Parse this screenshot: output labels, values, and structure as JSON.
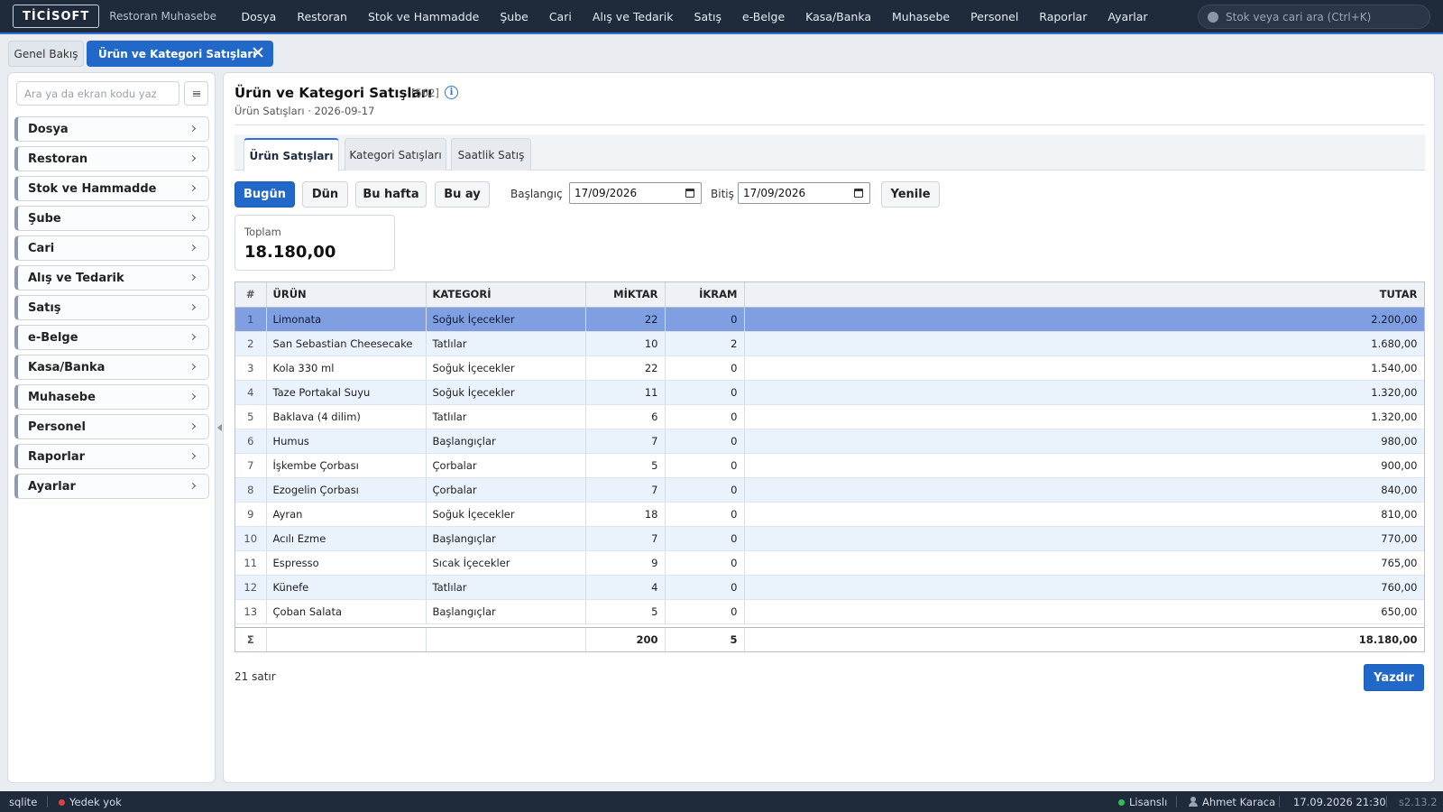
{
  "app": {
    "logo": "TİCİSOFT",
    "subtitle": "Restoran Muhasebe",
    "nav": [
      "Dosya",
      "Restoran",
      "Stok ve Hammadde",
      "Şube",
      "Cari",
      "Alış ve Tedarik",
      "Satış",
      "e-Belge",
      "Kasa/Banka",
      "Muhasebe",
      "Personel",
      "Raporlar",
      "Ayarlar"
    ],
    "search_placeholder": "Stok veya cari ara (Ctrl+K)"
  },
  "tabs": {
    "overview": "Genel Bakış",
    "active": "Ürün ve Kategori Satışları"
  },
  "sidebar": {
    "search_placeholder": "Ara ya da ekran kodu yaz",
    "items": [
      "Dosya",
      "Restoran",
      "Stok ve Hammadde",
      "Şube",
      "Cari",
      "Alış ve Tedarik",
      "Satış",
      "e-Belge",
      "Kasa/Banka",
      "Muhasebe",
      "Personel",
      "Raporlar",
      "Ayarlar"
    ]
  },
  "page": {
    "title": "Ürün ve Kategori Satışları",
    "code": "[562]",
    "subtitle": "Ürün Satışları · 2026-09-17",
    "subtabs": [
      "Ürün Satışları",
      "Kategori Satışları",
      "Saatlik Satış"
    ],
    "active_subtab": 0
  },
  "filters": {
    "today": "Bugün",
    "yesterday": "Dün",
    "this_week": "Bu hafta",
    "this_month": "Bu ay",
    "start_label": "Başlangıç",
    "start_value": "17/09/2026",
    "end_label": "Bitiş",
    "end_value": "17/09/2026",
    "refresh": "Yenile"
  },
  "summary": {
    "total_label": "Toplam",
    "total_value": "18.180,00"
  },
  "table": {
    "columns": [
      "#",
      "ÜRÜN",
      "KATEGORİ",
      "MİKTAR",
      "İKRAM",
      "TUTAR"
    ],
    "selected_row": 0,
    "rows": [
      [
        "1",
        "Limonata",
        "Soğuk İçecekler",
        "22",
        "0",
        "2.200,00"
      ],
      [
        "2",
        "San Sebastian Cheesecake",
        "Tatlılar",
        "10",
        "2",
        "1.680,00"
      ],
      [
        "3",
        "Kola 330 ml",
        "Soğuk İçecekler",
        "22",
        "0",
        "1.540,00"
      ],
      [
        "4",
        "Taze Portakal Suyu",
        "Soğuk İçecekler",
        "11",
        "0",
        "1.320,00"
      ],
      [
        "5",
        "Baklava (4 dilim)",
        "Tatlılar",
        "6",
        "0",
        "1.320,00"
      ],
      [
        "6",
        "Humus",
        "Başlangıçlar",
        "7",
        "0",
        "980,00"
      ],
      [
        "7",
        "İşkembe Çorbası",
        "Çorbalar",
        "5",
        "0",
        "900,00"
      ],
      [
        "8",
        "Ezogelin Çorbası",
        "Çorbalar",
        "7",
        "0",
        "840,00"
      ],
      [
        "9",
        "Ayran",
        "Soğuk İçecekler",
        "18",
        "0",
        "810,00"
      ],
      [
        "10",
        "Acılı Ezme",
        "Başlangıçlar",
        "7",
        "0",
        "770,00"
      ],
      [
        "11",
        "Espresso",
        "Sıcak İçecekler",
        "9",
        "0",
        "765,00"
      ],
      [
        "12",
        "Künefe",
        "Tatlılar",
        "4",
        "0",
        "760,00"
      ],
      [
        "13",
        "Çoban Salata",
        "Başlangıçlar",
        "5",
        "0",
        "650,00"
      ]
    ],
    "footer": [
      "Σ",
      "",
      "",
      "200",
      "5",
      "18.180,00"
    ]
  },
  "row_count": "21 satır",
  "print": "Yazdır",
  "status": {
    "db": "sqlite",
    "backup": "Yedek yok",
    "license": "Lisanslı",
    "user": "Ahmet Karaca",
    "datetime": "17.09.2026 21:30",
    "version": "s2.13.2"
  },
  "colors": {
    "accent": "#2268c8",
    "topbar": "#1f2a3a",
    "selected_row": "#7f9fe2",
    "license_dot": "#2fbf5a",
    "backup_dot": "#e04040"
  }
}
